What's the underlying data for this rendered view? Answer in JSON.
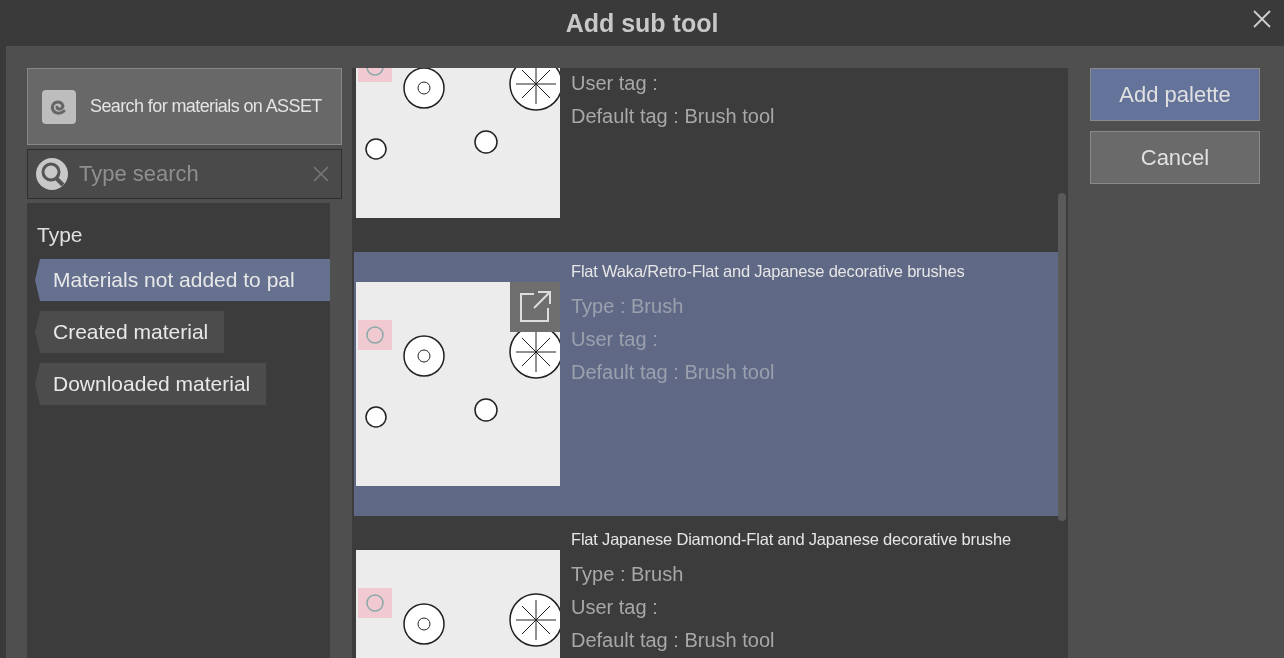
{
  "window": {
    "title": "Add sub tool"
  },
  "assets_button": {
    "label": "Search for materials on ASSET"
  },
  "search": {
    "placeholder": "Type search"
  },
  "filter": {
    "heading": "Type",
    "items": [
      {
        "label": "Materials not added to pal",
        "selected": true
      },
      {
        "label": "Created material",
        "selected": false
      },
      {
        "label": "Downloaded material",
        "selected": false
      }
    ]
  },
  "materials": [
    {
      "partial": true,
      "selected": false,
      "lines": [
        "User tag :",
        "Default tag : Brush tool"
      ]
    },
    {
      "partial": false,
      "selected": true,
      "title": "Flat Waka/Retro-Flat and Japanese decorative brushes",
      "lines": [
        "Type : Brush",
        "User tag :",
        "Default tag : Brush tool"
      ]
    },
    {
      "partial": false,
      "selected": false,
      "title": "Flat Japanese Diamond-Flat and Japanese decorative brushe",
      "lines": [
        "Type : Brush",
        "User tag :",
        "Default tag : Brush tool"
      ]
    }
  ],
  "buttons": [
    {
      "label": "Add palette",
      "kind": "primary"
    },
    {
      "label": "Cancel",
      "kind": "secondary"
    }
  ]
}
